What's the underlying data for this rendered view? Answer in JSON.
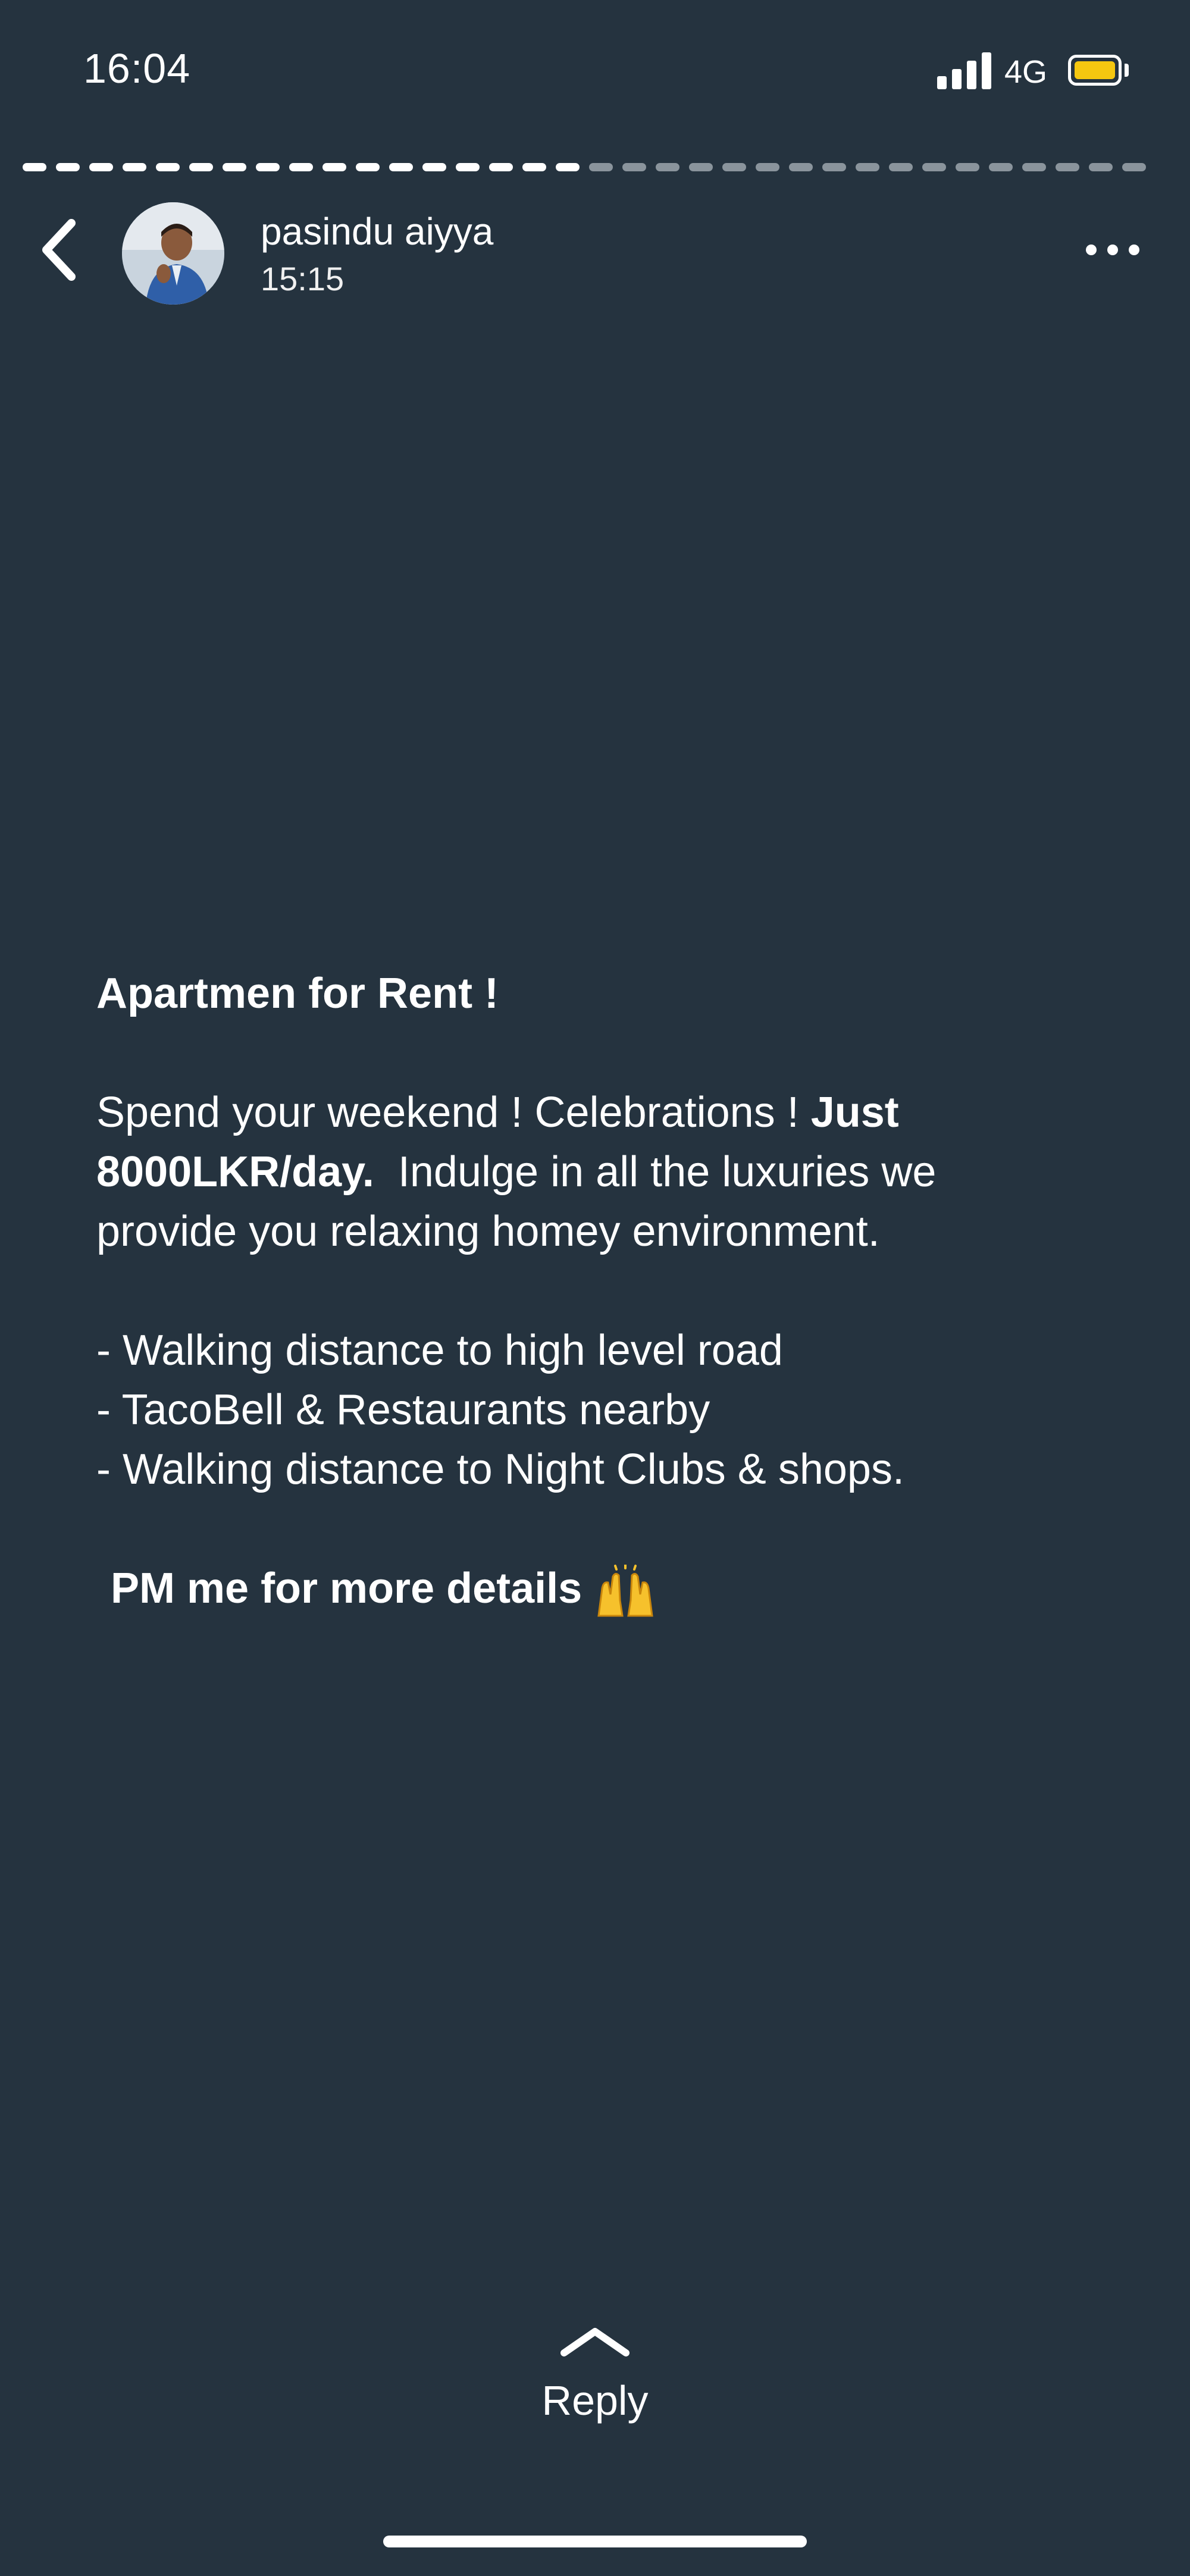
{
  "status_bar": {
    "time": "16:04",
    "network": "4G",
    "battery_color": "#f5c710"
  },
  "story": {
    "progress": 0.49
  },
  "header": {
    "username": "pasindu aiyya",
    "post_time": "15:15"
  },
  "message": {
    "title": "Apartmen for Rent !",
    "line1_regular": "Spend your weekend ! Celebrations ! ",
    "line1_bold": "Just",
    "line2_bold": "8000LKR/day.",
    "line2_regular": "  Indulge in all the luxuries we",
    "line3": "provide you relaxing homey environment.",
    "bullets": [
      "- Walking distance to high level road",
      "- TacoBell & Restaurants nearby",
      "- Walking distance to Night Clubs & shops."
    ],
    "cta": "PM me for more details",
    "cta_emoji": "raising-hands-emoji"
  },
  "reply": {
    "label": "Reply"
  },
  "colors": {
    "background": "#25333f",
    "text": "#ffffff",
    "progress_inactive": "#8a949c"
  }
}
